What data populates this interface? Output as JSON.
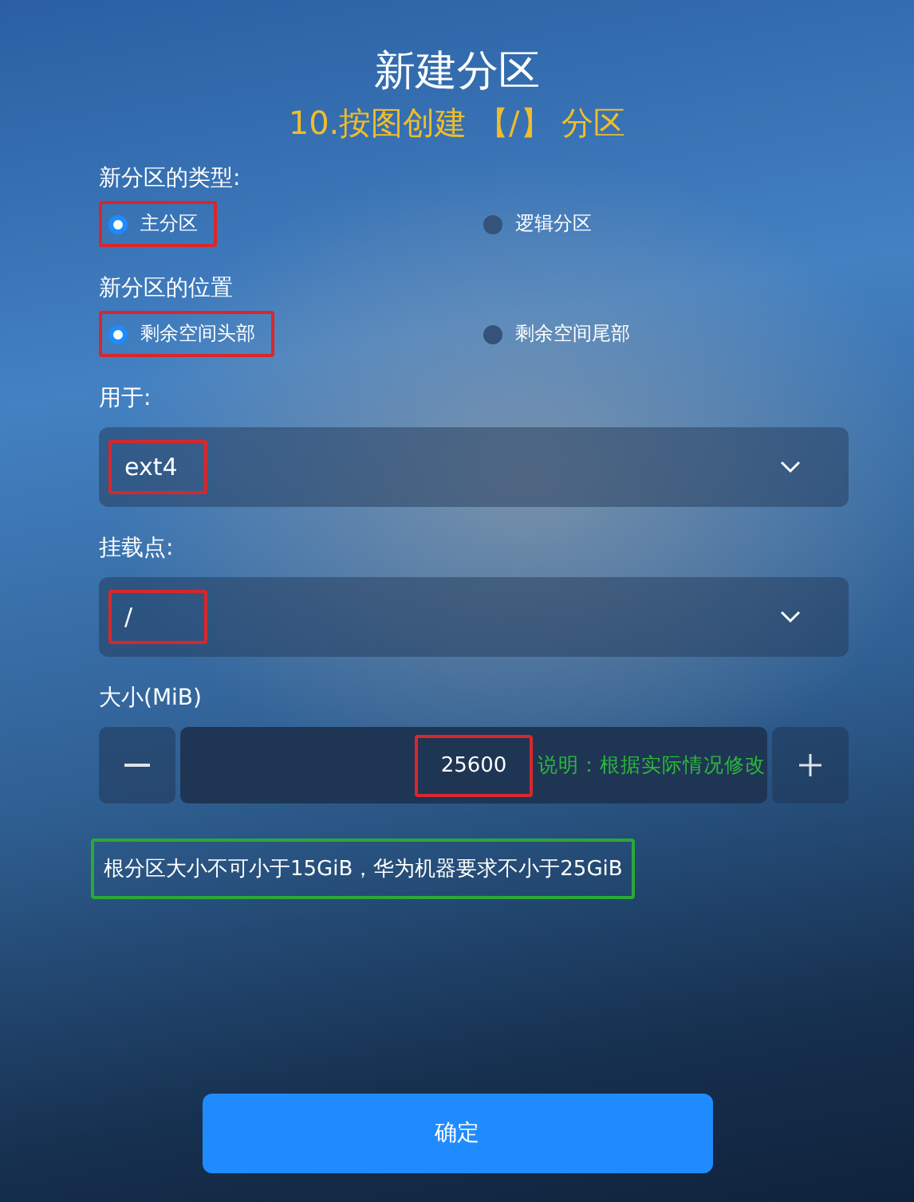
{
  "title": "新建分区",
  "subtitle": "10.按图创建 【/】 分区",
  "type_group": {
    "label": "新分区的类型:",
    "options": [
      {
        "label": "主分区",
        "selected": true,
        "highlighted": true
      },
      {
        "label": "逻辑分区",
        "selected": false,
        "highlighted": false
      }
    ]
  },
  "position_group": {
    "label": "新分区的位置",
    "options": [
      {
        "label": "剩余空间头部",
        "selected": true,
        "highlighted": true
      },
      {
        "label": "剩余空间尾部",
        "selected": false,
        "highlighted": false
      }
    ]
  },
  "filesystem": {
    "label": "用于:",
    "value": "ext4",
    "highlighted": true
  },
  "mount_point": {
    "label": "挂载点:",
    "value": "/",
    "highlighted": true
  },
  "size": {
    "label": "大小(MiB)",
    "value": "25600",
    "highlighted": true
  },
  "annotation": "说明：根据实际情况修改",
  "note": {
    "text": "根分区大小不可小于15GiB，华为机器要求不小于25GiB",
    "boxed": true
  },
  "confirm_button": "确定"
}
